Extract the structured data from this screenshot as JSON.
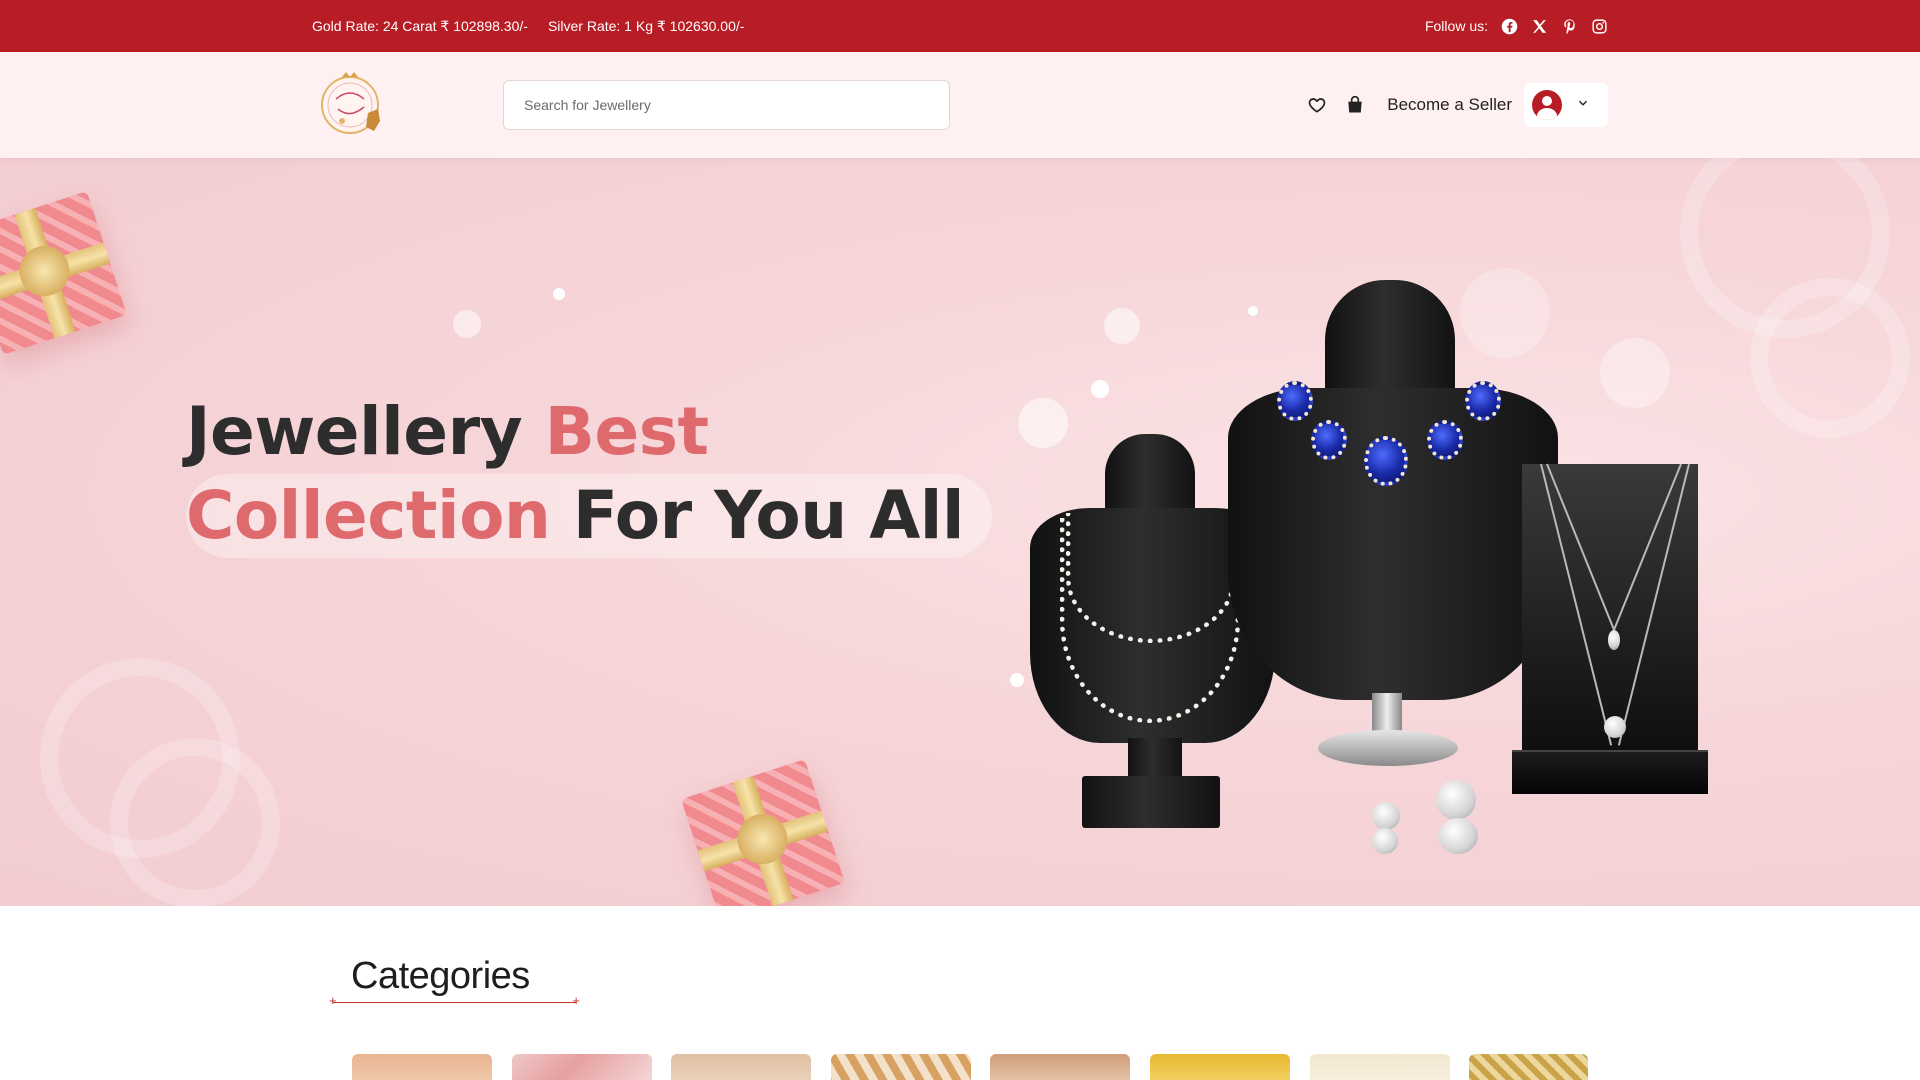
{
  "topbar": {
    "gold_rate": "Gold Rate: 24 Carat ₹ 102898.30/-",
    "silver_rate": "Silver Rate: 1 Kg ₹ 102630.00/-",
    "follow_label": "Follow us:",
    "social_icons": [
      "facebook-icon",
      "x-icon",
      "pinterest-icon",
      "instagram-icon"
    ]
  },
  "header": {
    "search_placeholder": "Search for Jewellery",
    "seller_label": "Become a Seller"
  },
  "hero": {
    "title_part1": "Jewellery ",
    "title_part2": "Best",
    "title_part3": "Collection",
    "title_part4": " For You All"
  },
  "categories": {
    "title": "Categories"
  },
  "colors": {
    "brand_red": "#b81c24",
    "accent_pink": "#df6a6e",
    "header_bg": "#fff1f1"
  }
}
